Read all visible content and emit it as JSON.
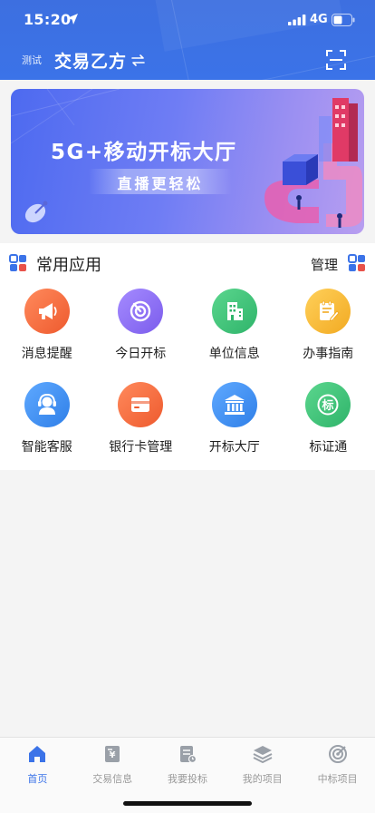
{
  "status_bar": {
    "time": "15:20",
    "network": "4G",
    "icons": [
      "location-arrow-icon",
      "signal-icon",
      "battery-icon"
    ]
  },
  "header": {
    "env_tag": "测试",
    "org_name": "交易乙方",
    "switch_icon": "switch-arrows-icon",
    "scan_icon": "scan-icon",
    "color": "#3b73e8"
  },
  "banner": {
    "title": "5G+移动开标大厅",
    "subtitle": "直播更轻松"
  },
  "apps": {
    "section_title": "常用应用",
    "manage_label": "管理",
    "items": [
      {
        "label": "消息提醒",
        "icon": "megaphone-icon",
        "color": "#f26a3d"
      },
      {
        "label": "今日开标",
        "icon": "radar-icon",
        "color": "#8a6cf0"
      },
      {
        "label": "单位信息",
        "icon": "building-icon",
        "color": "#3cc07a"
      },
      {
        "label": "办事指南",
        "icon": "guide-note-icon",
        "color": "#f5b83c"
      },
      {
        "label": "智能客服",
        "icon": "headset-icon",
        "color": "#3b8ef0"
      },
      {
        "label": "银行卡管理",
        "icon": "bank-card-icon",
        "color": "#f26a3d"
      },
      {
        "label": "开标大厅",
        "icon": "hall-icon",
        "color": "#3b8ef0"
      },
      {
        "label": "标证通",
        "icon": "biaozhengtong-icon",
        "color": "#3cc07a"
      }
    ]
  },
  "tabbar": {
    "active_color": "#3b73e8",
    "items": [
      {
        "label": "首页",
        "icon": "home-icon",
        "active": true
      },
      {
        "label": "交易信息",
        "icon": "trade-doc-icon",
        "active": false
      },
      {
        "label": "我要投标",
        "icon": "bid-doc-icon",
        "active": false
      },
      {
        "label": "我的项目",
        "icon": "layers-icon",
        "active": false
      },
      {
        "label": "中标项目",
        "icon": "target-icon",
        "active": false
      }
    ]
  }
}
